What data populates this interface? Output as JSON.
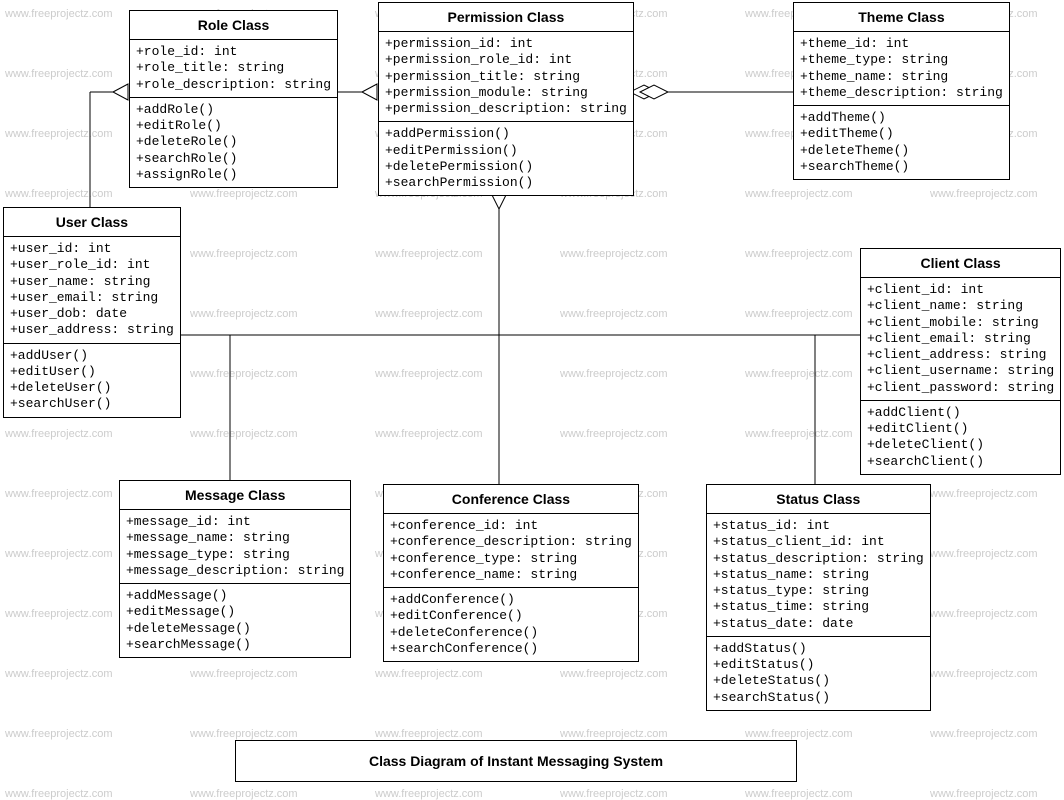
{
  "diagram_title": "Class Diagram of Instant Messaging System",
  "watermark_text": "www.freeprojectz.com",
  "classes": {
    "role": {
      "title": "Role Class",
      "attrs": [
        "+role_id: int",
        "+role_title: string",
        "+role_description: string"
      ],
      "ops": [
        "+addRole()",
        "+editRole()",
        "+deleteRole()",
        "+searchRole()",
        "+assignRole()"
      ]
    },
    "permission": {
      "title": "Permission Class",
      "attrs": [
        "+permission_id: int",
        "+permission_role_id: int",
        "+permission_title: string",
        "+permission_module: string",
        "+permission_description: string"
      ],
      "ops": [
        "+addPermission()",
        "+editPermission()",
        "+deletePermission()",
        "+searchPermission()"
      ]
    },
    "theme": {
      "title": "Theme Class",
      "attrs": [
        "+theme_id: int",
        "+theme_type: string",
        "+theme_name: string",
        "+theme_description: string"
      ],
      "ops": [
        "+addTheme()",
        "+editTheme()",
        "+deleteTheme()",
        "+searchTheme()"
      ]
    },
    "user": {
      "title": "User Class",
      "attrs": [
        "+user_id: int",
        "+user_role_id: int",
        "+user_name: string",
        "+user_email: string",
        "+user_dob: date",
        "+user_address: string"
      ],
      "ops": [
        "+addUser()",
        "+editUser()",
        "+deleteUser()",
        "+searchUser()"
      ]
    },
    "client": {
      "title": "Client Class",
      "attrs": [
        "+client_id: int",
        "+client_name: string",
        "+client_mobile: string",
        "+client_email: string",
        "+client_address: string",
        "+client_username: string",
        "+client_password: string"
      ],
      "ops": [
        "+addClient()",
        "+editClient()",
        "+deleteClient()",
        "+searchClient()"
      ]
    },
    "message": {
      "title": "Message Class",
      "attrs": [
        "+message_id: int",
        "+message_name: string",
        "+message_type: string",
        "+message_description: string"
      ],
      "ops": [
        "+addMessage()",
        "+editMessage()",
        "+deleteMessage()",
        "+searchMessage()"
      ]
    },
    "conference": {
      "title": "Conference Class",
      "attrs": [
        "+conference_id: int",
        "+conference_description: string",
        "+conference_type: string",
        "+conference_name: string"
      ],
      "ops": [
        "+addConference()",
        "+editConference()",
        "+deleteConference()",
        "+searchConference()"
      ]
    },
    "status": {
      "title": "Status Class",
      "attrs": [
        "+status_id: int",
        "+status_client_id: int",
        "+status_description: string",
        "+status_name: string",
        "+status_type: string",
        "+status_time: string",
        "+status_date: date"
      ],
      "ops": [
        "+addStatus()",
        "+editStatus()",
        "+deleteStatus()",
        "+searchStatus()"
      ]
    }
  }
}
